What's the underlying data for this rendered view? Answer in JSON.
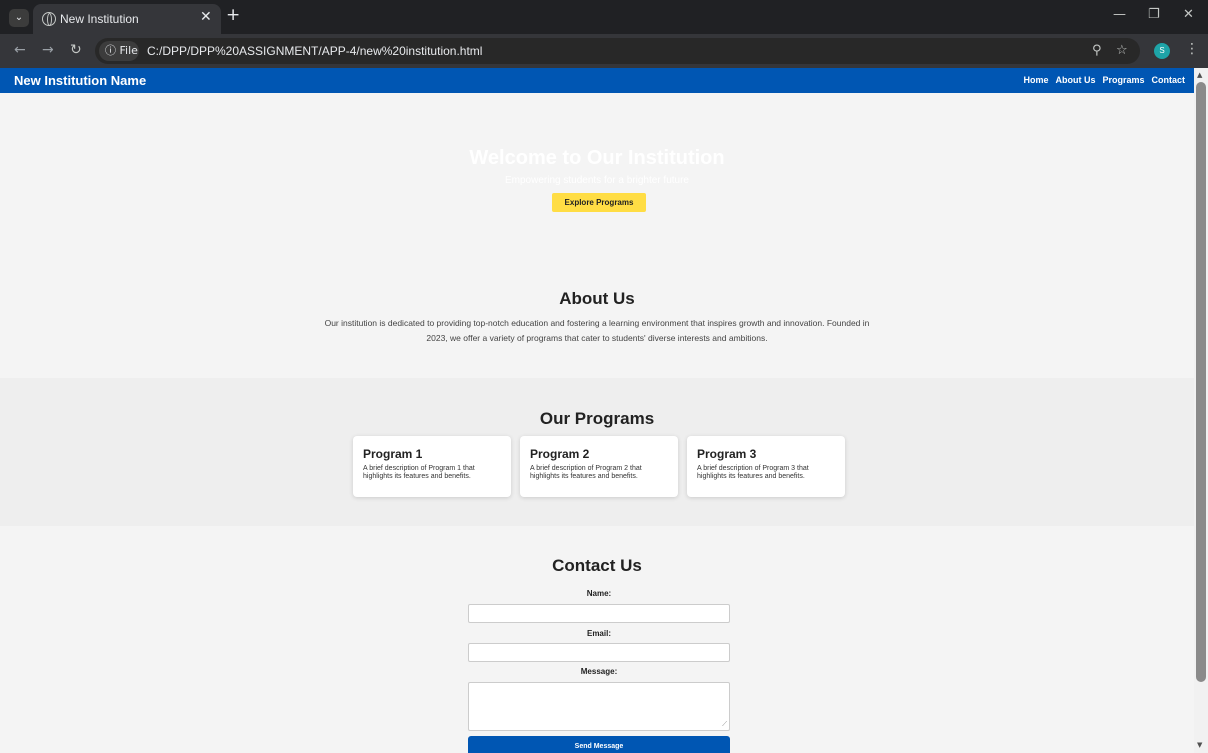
{
  "browser": {
    "tab_title": "New Institution",
    "address_chip": "ⓘ File",
    "url": "C:/DPP/DPP%20ASSIGNMENT/APP-4/new%20institution.html",
    "avatar_letter": "S"
  },
  "header": {
    "site_name": "New Institution Name",
    "nav": [
      "Home",
      "About Us",
      "Programs",
      "Contact"
    ]
  },
  "hero": {
    "title": "Welcome to Our Institution",
    "subtitle": "Empowering students for a brighter future",
    "button_label": "Explore Programs"
  },
  "about": {
    "heading": "About Us",
    "text": "Our institution is dedicated to providing top-notch education and fostering a learning environment that inspires growth and innovation. Founded in 2023, we offer a variety of programs that cater to students' diverse interests and ambitions."
  },
  "programs": {
    "heading": "Our Programs",
    "items": [
      {
        "title": "Program 1",
        "description": "A brief description of Program 1 that highlights its features and benefits."
      },
      {
        "title": "Program 2",
        "description": "A brief description of Program 2 that highlights its features and benefits."
      },
      {
        "title": "Program 3",
        "description": "A brief description of Program 3 that highlights its features and benefits."
      }
    ]
  },
  "contact": {
    "heading": "Contact Us",
    "name_label": "Name:",
    "email_label": "Email:",
    "message_label": "Message:",
    "submit_label": "Send Message"
  },
  "colors": {
    "brand": "#0056b3",
    "accent": "#ffdd44"
  },
  "icons": [
    "tab-search-icon",
    "globe-icon",
    "close-icon",
    "plus-icon",
    "back-icon",
    "forward-icon",
    "reload-icon",
    "zoom-icon",
    "star-icon",
    "more-icon"
  ]
}
